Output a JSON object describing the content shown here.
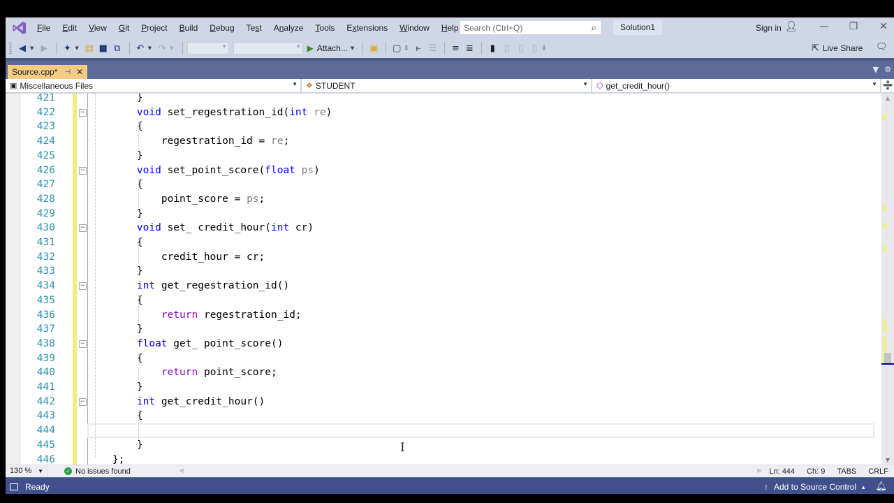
{
  "menubar": {
    "items": [
      {
        "label": "File",
        "accel": "F"
      },
      {
        "label": "Edit",
        "accel": "E"
      },
      {
        "label": "View",
        "accel": "V"
      },
      {
        "label": "Git",
        "accel": "G"
      },
      {
        "label": "Project",
        "accel": "P"
      },
      {
        "label": "Build",
        "accel": "B"
      },
      {
        "label": "Debug",
        "accel": "D"
      },
      {
        "label": "Test",
        "accel": "s"
      },
      {
        "label": "Analyze",
        "accel": "n"
      },
      {
        "label": "Tools",
        "accel": "T"
      },
      {
        "label": "Extensions",
        "accel": "x"
      },
      {
        "label": "Window",
        "accel": "W"
      },
      {
        "label": "Help",
        "accel": "H"
      }
    ],
    "search_placeholder": "Search (Ctrl+Q)",
    "solution_name": "Solution1",
    "sign_in": "Sign in"
  },
  "toolbar": {
    "attach_label": "Attach...",
    "live_share_label": "Live Share"
  },
  "tabs": [
    {
      "label": "Source.cpp*",
      "active": true,
      "modified": true
    }
  ],
  "navbar": {
    "project": "Miscellaneous Files",
    "scope": "STUDENT",
    "member": "get_credit_hour()"
  },
  "editor": {
    "lines": [
      {
        "num": "421",
        "html": "    }"
      },
      {
        "num": "422",
        "fold": true,
        "tokens": [
          [
            "    ",
            ""
          ],
          [
            "void",
            "kw"
          ],
          [
            " set_regestration_id(",
            ""
          ],
          [
            "int",
            "kw"
          ],
          [
            " ",
            ""
          ],
          [
            "re",
            "param"
          ],
          [
            ")",
            ""
          ]
        ]
      },
      {
        "num": "423",
        "tokens": [
          [
            "    {",
            ""
          ]
        ]
      },
      {
        "num": "424",
        "tokens": [
          [
            "        regestration_id = ",
            ""
          ],
          [
            "re",
            "param"
          ],
          [
            ";",
            ""
          ]
        ]
      },
      {
        "num": "425",
        "tokens": [
          [
            "    }",
            ""
          ]
        ]
      },
      {
        "num": "426",
        "fold": true,
        "tokens": [
          [
            "    ",
            ""
          ],
          [
            "void",
            "kw"
          ],
          [
            " set_point_score(",
            ""
          ],
          [
            "float",
            "kw"
          ],
          [
            " ",
            ""
          ],
          [
            "ps",
            "param"
          ],
          [
            ")",
            ""
          ]
        ]
      },
      {
        "num": "427",
        "tokens": [
          [
            "    {",
            ""
          ]
        ]
      },
      {
        "num": "428",
        "tokens": [
          [
            "        point_score = ",
            ""
          ],
          [
            "ps",
            "param"
          ],
          [
            ";",
            ""
          ]
        ]
      },
      {
        "num": "429",
        "tokens": [
          [
            "    }",
            ""
          ]
        ]
      },
      {
        "num": "430",
        "fold": true,
        "tokens": [
          [
            "    ",
            ""
          ],
          [
            "void",
            "kw"
          ],
          [
            " set_ credit_hour(",
            ""
          ],
          [
            "int",
            "kw"
          ],
          [
            " cr)",
            ""
          ]
        ]
      },
      {
        "num": "431",
        "tokens": [
          [
            "    {",
            ""
          ]
        ]
      },
      {
        "num": "432",
        "tokens": [
          [
            "        credit_hour = cr;",
            ""
          ]
        ]
      },
      {
        "num": "433",
        "tokens": [
          [
            "    }",
            ""
          ]
        ]
      },
      {
        "num": "434",
        "fold": true,
        "tokens": [
          [
            "    ",
            ""
          ],
          [
            "int",
            "kw"
          ],
          [
            " get_regestration_id()",
            ""
          ]
        ]
      },
      {
        "num": "435",
        "tokens": [
          [
            "    {",
            ""
          ]
        ]
      },
      {
        "num": "436",
        "tokens": [
          [
            "        ",
            ""
          ],
          [
            "return",
            "kw2"
          ],
          [
            " regestration_id;",
            ""
          ]
        ]
      },
      {
        "num": "437",
        "tokens": [
          [
            "    }",
            ""
          ]
        ]
      },
      {
        "num": "438",
        "fold": true,
        "tokens": [
          [
            "    ",
            ""
          ],
          [
            "float",
            "kw"
          ],
          [
            " get_ point_score()",
            ""
          ]
        ]
      },
      {
        "num": "439",
        "tokens": [
          [
            "    {",
            ""
          ]
        ]
      },
      {
        "num": "440",
        "tokens": [
          [
            "        ",
            ""
          ],
          [
            "return",
            "kw2"
          ],
          [
            " point_score;",
            ""
          ]
        ]
      },
      {
        "num": "441",
        "tokens": [
          [
            "    }",
            ""
          ]
        ]
      },
      {
        "num": "442",
        "fold": true,
        "tokens": [
          [
            "    ",
            ""
          ],
          [
            "int",
            "kw"
          ],
          [
            " get_credit_hour()",
            ""
          ]
        ]
      },
      {
        "num": "443",
        "tokens": [
          [
            "    {",
            ""
          ]
        ]
      },
      {
        "num": "444",
        "tokens": [
          [
            "",
            ""
          ]
        ],
        "current": true
      },
      {
        "num": "445",
        "tokens": [
          [
            "    }",
            ""
          ]
        ]
      },
      {
        "num": "446",
        "tokens": [
          [
            "};",
            ""
          ]
        ]
      }
    ]
  },
  "editor_status": {
    "zoom": "130 %",
    "issues": "No issues found",
    "line": "Ln: 444",
    "col": "Ch: 9",
    "indent": "TABS",
    "eol": "CRLF"
  },
  "status": {
    "ready": "Ready",
    "source_control": "Add to Source Control"
  },
  "colors": {
    "chrome": "#cfd6e5",
    "tab_active": "#f5cc84",
    "status_bar": "#40508d",
    "keyword": "#0000ff",
    "control_keyword": "#8f08c4",
    "line_number": "#2b91af",
    "change_marker": "#f1ed7a"
  }
}
